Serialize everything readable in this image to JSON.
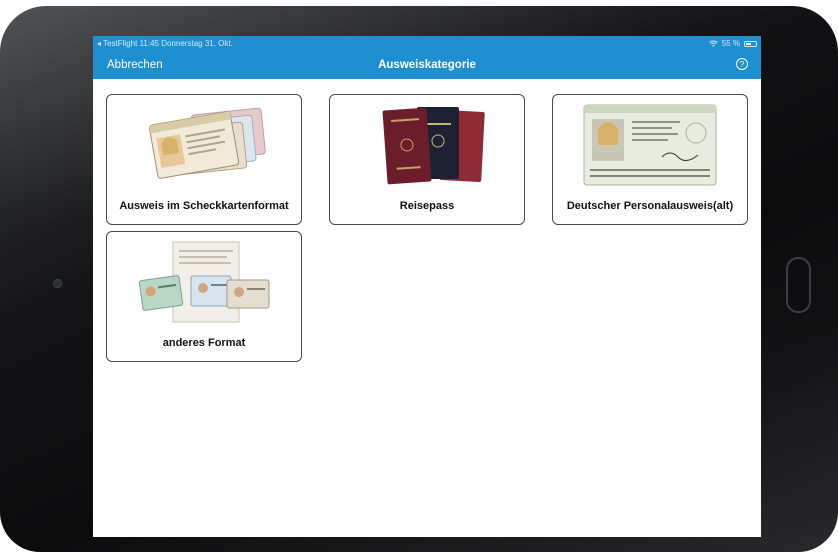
{
  "status": {
    "back_app": "◂ TestFlight",
    "time": "11:45",
    "date": "Donnerstag 31. Okt.",
    "battery": "55 %",
    "battery_level": 0.55,
    "wifi_icon": "wifi-icon"
  },
  "nav": {
    "cancel": "Abbrechen",
    "title": "Ausweiskategorie",
    "help": "?"
  },
  "cards": [
    {
      "label": "Ausweis im Scheckkartenformat",
      "icon": "id-cards-image"
    },
    {
      "label": "Reisepass",
      "icon": "passports-image"
    },
    {
      "label": "Deutscher Personalausweis(alt)",
      "icon": "old-id-card-image"
    },
    {
      "label": "anderes Format",
      "icon": "other-documents-image"
    }
  ]
}
